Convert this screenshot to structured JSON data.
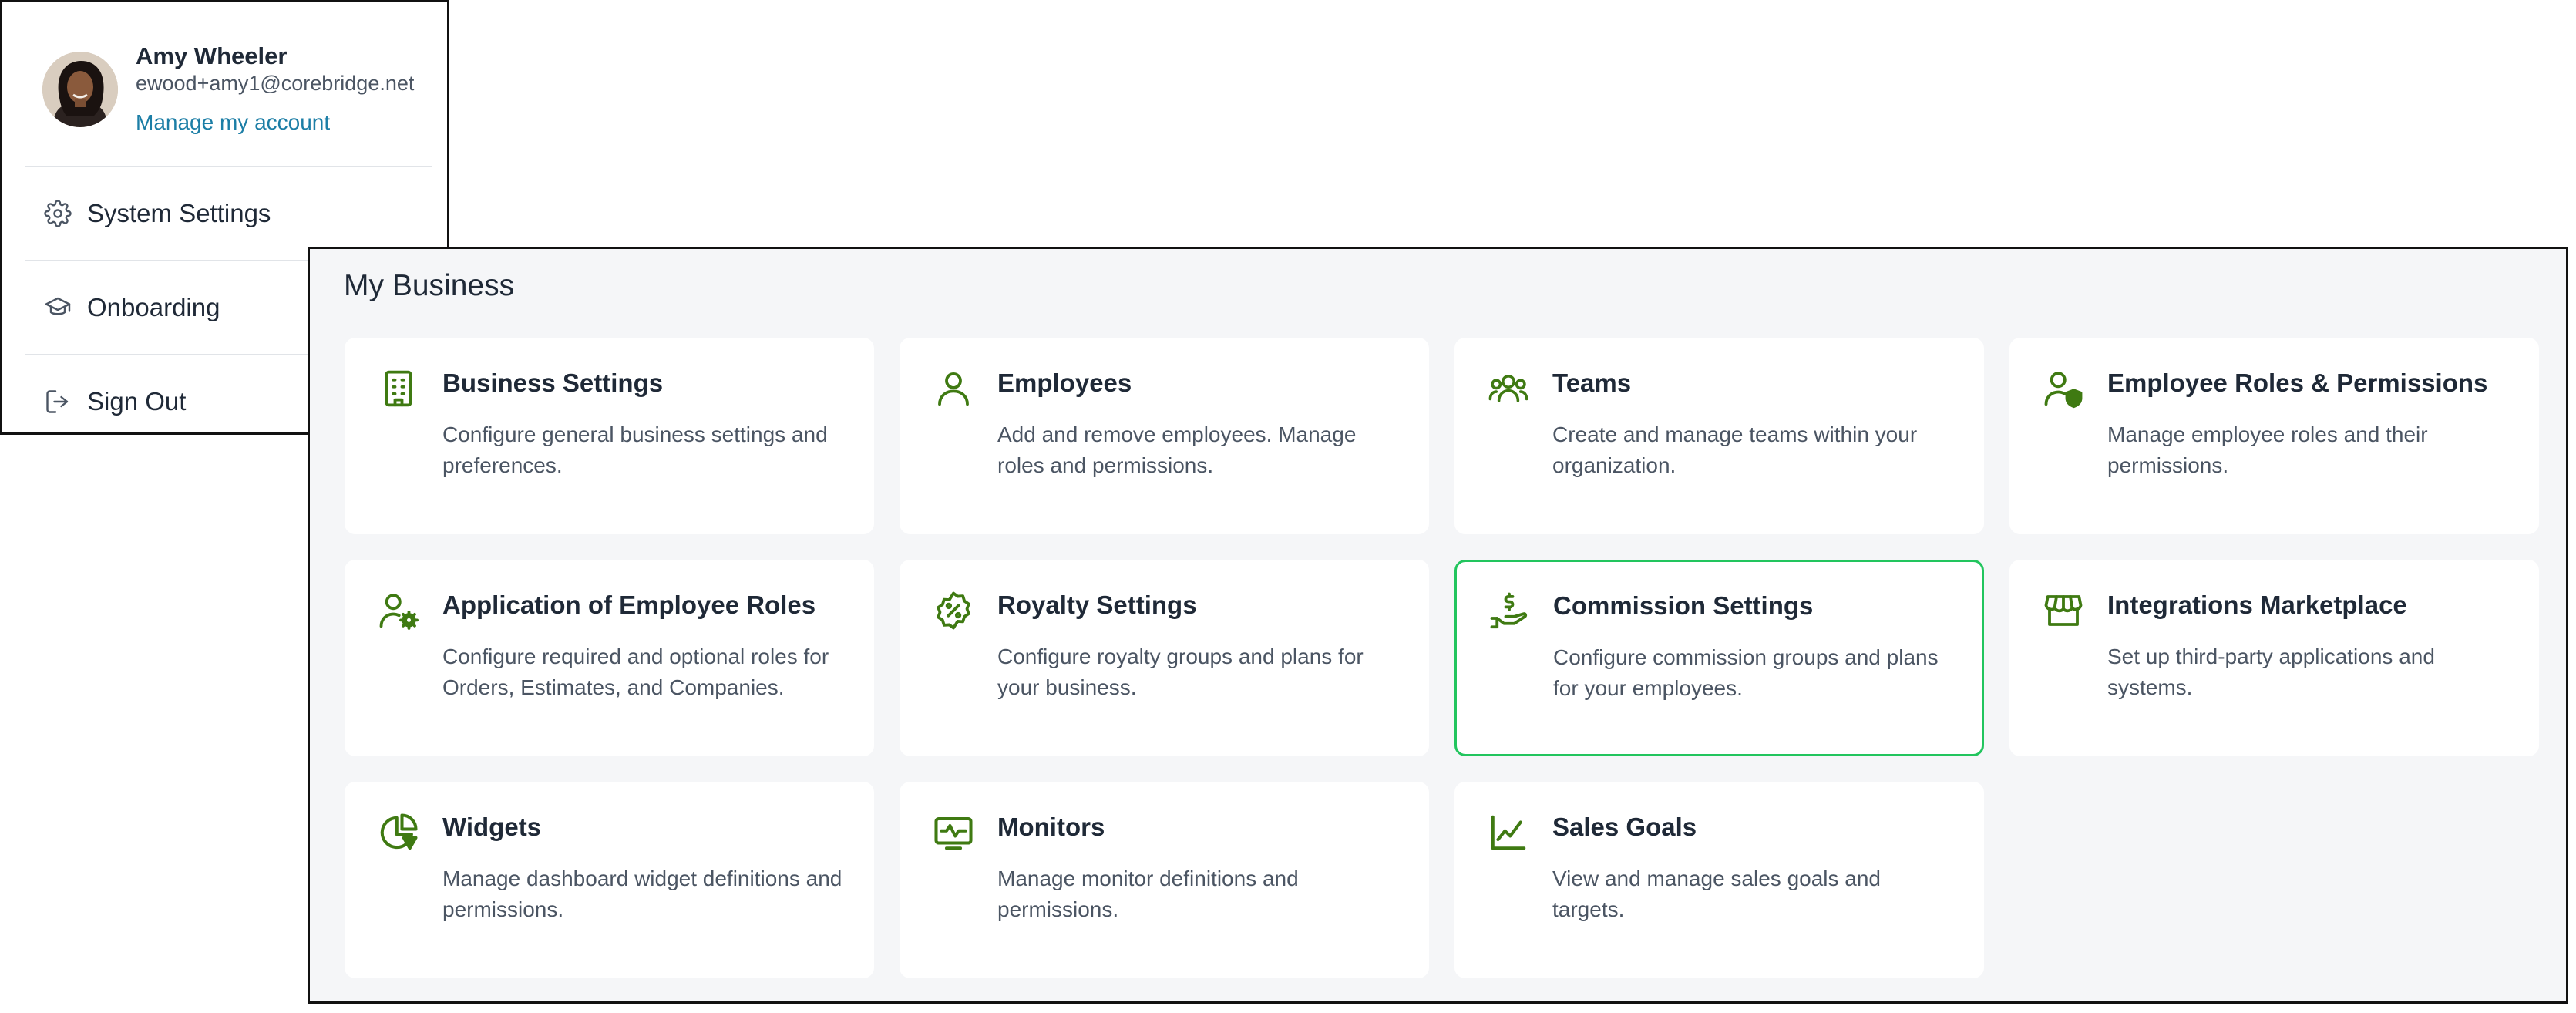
{
  "account_menu": {
    "user_name": "Amy Wheeler",
    "user_email": "ewood+amy1@corebridge.net",
    "manage_link": "Manage my account",
    "items": [
      {
        "label": "System Settings",
        "icon": "gear-icon"
      },
      {
        "label": "Onboarding",
        "icon": "graduation-cap-icon"
      },
      {
        "label": "Sign Out",
        "icon": "sign-out-icon"
      }
    ]
  },
  "business": {
    "title": "My Business",
    "accent_color": "#3f7a12",
    "selected_border_color": "#22c55e",
    "cards": [
      {
        "title": "Business Settings",
        "description": "Configure general business settings and preferences.",
        "icon": "building-icon"
      },
      {
        "title": "Employees",
        "description": "Add and remove employees. Manage roles and permissions.",
        "icon": "user-icon"
      },
      {
        "title": "Teams",
        "description": "Create and manage teams within your organization.",
        "icon": "users-group-icon"
      },
      {
        "title": "Employee Roles & Permissions",
        "description": "Manage employee roles and their permissions.",
        "icon": "user-shield-icon"
      },
      {
        "title": "Application of Employee Roles",
        "description": "Configure required and optional roles for Orders, Estimates, and Companies.",
        "icon": "user-gear-icon"
      },
      {
        "title": "Royalty Settings",
        "description": "Configure royalty groups and plans for your business.",
        "icon": "percent-badge-icon"
      },
      {
        "title": "Commission Settings",
        "description": "Configure commission groups and plans for your employees.",
        "icon": "hand-dollar-icon",
        "selected": true
      },
      {
        "title": "Integrations Marketplace",
        "description": "Set up third-party applications and systems.",
        "icon": "storefront-icon"
      },
      {
        "title": "Widgets",
        "description": "Manage dashboard widget definitions and permissions.",
        "icon": "pie-chart-icon"
      },
      {
        "title": "Monitors",
        "description": "Manage monitor definitions and permissions.",
        "icon": "monitor-pulse-icon"
      },
      {
        "title": "Sales Goals",
        "description": "View and manage sales goals and targets.",
        "icon": "line-chart-icon"
      }
    ]
  }
}
